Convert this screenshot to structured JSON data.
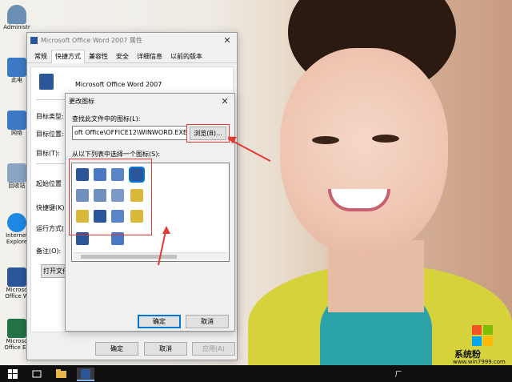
{
  "desktop": {
    "icons": [
      {
        "label": "Administr",
        "icon": "user-icon",
        "color": "#6b8fb3"
      },
      {
        "label": "此电",
        "icon": "computer-icon",
        "color": "#3c7ac7"
      },
      {
        "label": "网络",
        "icon": "network-icon",
        "color": "#3c7ac7"
      },
      {
        "label": "回收站",
        "icon": "recycle-bin-icon",
        "color": "#8aa4c4"
      },
      {
        "label": "Internet Explore",
        "icon": "ie-icon",
        "color": "#1e88e5"
      },
      {
        "label": "Microso Office W",
        "icon": "word-icon",
        "color": "#2b579a"
      },
      {
        "label": "Microso Office Ex",
        "icon": "excel-icon",
        "color": "#217346"
      }
    ]
  },
  "properties_window": {
    "title": "Microsoft Office Word 2007 属性",
    "tabs": [
      "常规",
      "快捷方式",
      "兼容性",
      "安全",
      "详细信息",
      "以前的版本"
    ],
    "active_tab": 1,
    "app_name": "Microsoft Office Word 2007",
    "labels": {
      "target_type": "目标类型:",
      "target_location": "目标位置:",
      "target": "目标(T):",
      "start_in": "起始位置",
      "shortcut_key": "快捷键(K)",
      "run": "运行方式(",
      "comment": "备注(O):",
      "open_location": "打开文件"
    },
    "buttons": {
      "ok": "确定",
      "cancel": "取消",
      "apply": "应用(A)"
    }
  },
  "change_icon_dialog": {
    "title": "更改图标",
    "find_label": "查找此文件中的图标(L):",
    "path_value": "oft Office\\OFFICE12\\WINWORD.EXE",
    "browse": "浏览(B)...",
    "select_label": "从以下列表中选择一个图标(S):",
    "ok": "确定",
    "cancel": "取消",
    "icon_grid": [
      {
        "icon": "word-doc-icon",
        "color": "#2b579a"
      },
      {
        "icon": "word-template-icon",
        "color": "#4a78c2"
      },
      {
        "icon": "word-xml-icon",
        "color": "#5a86c8"
      },
      {
        "icon": "word-macro-icon",
        "color": "#2b579a",
        "selected": true
      },
      {
        "icon": "document-list-icon",
        "color": "#6f8fbf"
      },
      {
        "icon": "table-doc-icon",
        "color": "#6f8fbf"
      },
      {
        "icon": "shapes-doc-icon",
        "color": "#7c99c8"
      },
      {
        "icon": "folder-doc-icon",
        "color": "#d8b93a"
      },
      {
        "icon": "grid-doc-icon",
        "color": "#d8b93a"
      },
      {
        "icon": "word-page-icon",
        "color": "#2b579a"
      },
      {
        "icon": "merge-doc-icon",
        "color": "#5a86c8"
      },
      {
        "icon": "folder-shape-icon",
        "color": "#d8b93a"
      },
      {
        "icon": "word-small-icon",
        "color": "#2b579a"
      },
      {
        "icon": "word-edit-icon",
        "color": "#4a78c2"
      }
    ]
  },
  "taskbar": {
    "items": [
      {
        "icon": "windows-start-icon"
      },
      {
        "icon": "task-view-icon"
      },
      {
        "icon": "file-explorer-icon"
      },
      {
        "icon": "word-taskbar-icon"
      }
    ],
    "tray_glyph": "ㄏ"
  },
  "watermark": {
    "name": "系统粉",
    "url": "www.win7999.com"
  },
  "colors": {
    "accent": "#0078d7",
    "annotation": "#e53935",
    "taskbar": "#101010"
  }
}
